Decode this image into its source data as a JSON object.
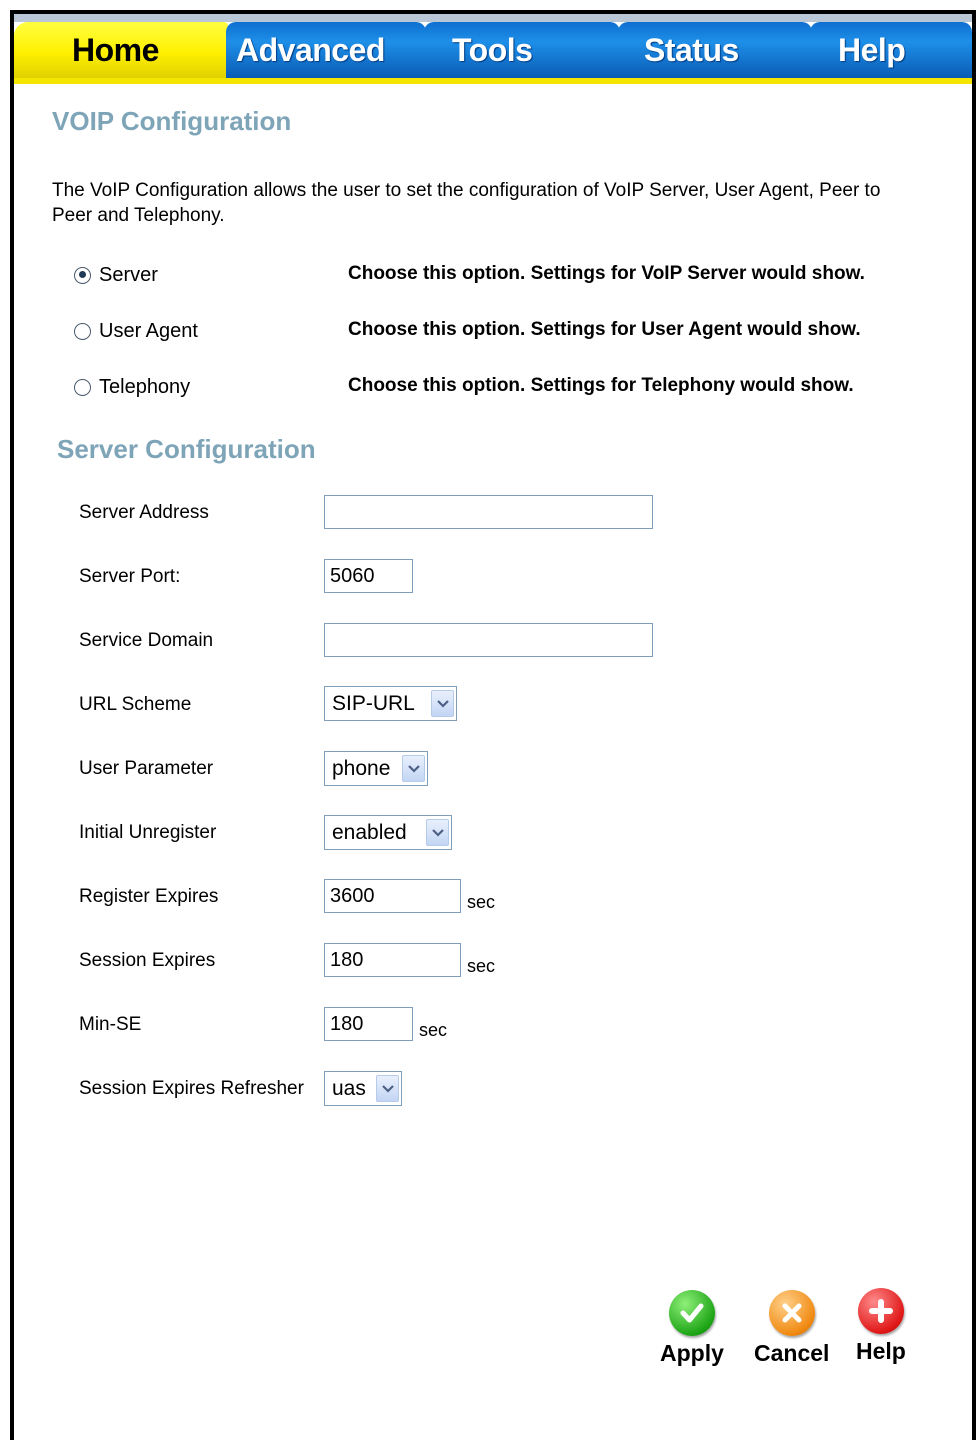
{
  "tabs": {
    "home": "Home",
    "advanced": "Advanced",
    "tools": "Tools",
    "status": "Status",
    "help": "Help",
    "active": "Home",
    "colors": {
      "active": "#fff000",
      "inactive": "#1e8fe8"
    }
  },
  "voip": {
    "title": "VOIP Configuration",
    "description": "The VoIP Configuration allows the user to set the configuration of VoIP Server, User Agent, Peer to Peer and Telephony.",
    "options": [
      {
        "label": "Server",
        "hint": "Choose this option. Settings for VoIP Server would show.",
        "selected": true
      },
      {
        "label": "User Agent",
        "hint": "Choose this option. Settings for User Agent would show.",
        "selected": false
      },
      {
        "label": "Telephony",
        "hint": "Choose this option. Settings for Telephony would show.",
        "selected": false
      }
    ]
  },
  "server_config": {
    "title": "Server Configuration",
    "server_address": {
      "label": "Server Address",
      "value": ""
    },
    "server_port": {
      "label": "Server Port:",
      "value": "5060"
    },
    "service_domain": {
      "label": "Service Domain",
      "value": ""
    },
    "url_scheme": {
      "label": "URL Scheme",
      "value": "SIP-URL"
    },
    "user_parameter": {
      "label": "User Parameter",
      "value": "phone"
    },
    "initial_unregister": {
      "label": "Initial Unregister",
      "value": "enabled"
    },
    "register_expires": {
      "label": "Register Expires",
      "value": "3600",
      "unit": "sec"
    },
    "session_expires": {
      "label": "Session Expires",
      "value": "180",
      "unit": "sec"
    },
    "min_se": {
      "label": "Min-SE",
      "value": "180",
      "unit": "sec"
    },
    "session_expires_refresher": {
      "label": "Session Expires Refresher",
      "value": "uas"
    }
  },
  "actions": {
    "apply": {
      "label": "Apply",
      "icon": "check-icon",
      "color": "#1ea516"
    },
    "cancel": {
      "label": "Cancel",
      "icon": "x-icon",
      "color": "#f08a12"
    },
    "help": {
      "label": "Help",
      "icon": "plus-icon",
      "color": "#e01818"
    }
  }
}
